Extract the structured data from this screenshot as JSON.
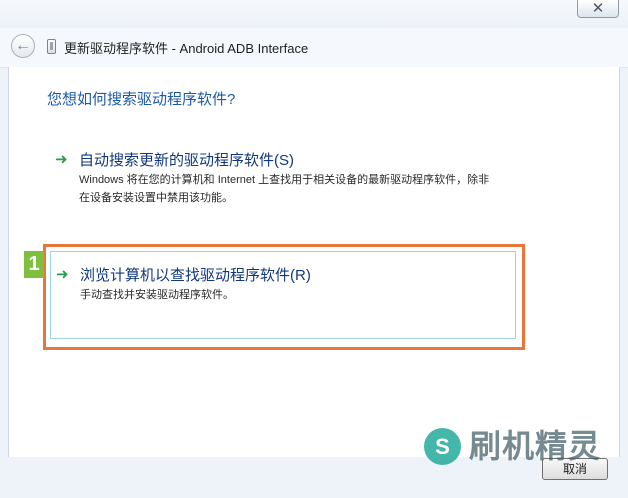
{
  "window": {
    "title": "更新驱动程序软件 - Android ADB Interface",
    "close_symbol": "✕",
    "back_symbol": "←"
  },
  "instruction": "您想如何搜索驱动程序软件?",
  "options": [
    {
      "title": "自动搜索更新的驱动程序软件(S)",
      "description": "Windows 将在您的计算机和 Internet 上查找用于相关设备的最新驱动程序软件，除非在设备安装设置中禁用该功能。",
      "icon": "green-arrow-icon"
    },
    {
      "title": "浏览计算机以查找驱动程序软件(R)",
      "description": "手动查找并安装驱动程序软件。",
      "icon": "green-arrow-icon"
    }
  ],
  "annotation": {
    "step_number": "1"
  },
  "footer": {
    "cancel_label": "取消"
  },
  "watermark": {
    "brand_text": "刷机精灵",
    "logo_mark": "S"
  },
  "colors": {
    "instruction_blue": "#1c5aa6",
    "option_title_blue": "#11387c",
    "arrow_green": "#24a146",
    "highlight_orange": "#e9773b",
    "badge_green": "#7fbe3f"
  }
}
